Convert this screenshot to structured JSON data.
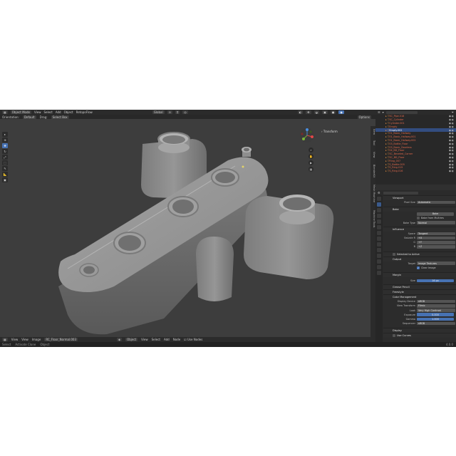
{
  "topbar": {
    "mode": "Object Mode",
    "menus": [
      "View",
      "Select",
      "Add",
      "Object",
      "RetopoFlow"
    ],
    "transform_orientation": "Global"
  },
  "toolsettings": {
    "orientation_label": "Orientation:",
    "orientation_value": "Default",
    "drag_label": "Drag:",
    "drag_value": "Select Box",
    "options": "Options"
  },
  "npanel": {
    "tab": "Transform"
  },
  "side_tabs": [
    "Item",
    "Tool",
    "View",
    "BlenderKit",
    "Mesh Machine",
    "Machine Tools"
  ],
  "outliner": {
    "search_placeholder": "",
    "rows": [
      {
        "name": "SC_Pipe.018",
        "red": true
      },
      {
        "name": "SC_Cylinder",
        "red": true
      },
      {
        "name": "Cylinder.001",
        "red": true
      },
      {
        "name": "Empty",
        "red": true
      },
      {
        "name": "Empty.002",
        "red": false,
        "highlight": true
      },
      {
        "name": "01_Basic_Hallway",
        "red": true
      },
      {
        "name": "01_Basic_Hallway.001",
        "red": true
      },
      {
        "name": "01_Basic_Hallway.002",
        "red": true
      },
      {
        "name": "03_Bottle_Floor",
        "red": true
      },
      {
        "name": "03_Basic_Doorless",
        "red": true
      },
      {
        "name": "04_BD_Floor",
        "red": true
      },
      {
        "name": "SC_Beveled_Corner",
        "red": true
      },
      {
        "name": "SC_BD_Floor",
        "red": true
      },
      {
        "name": "Ring_007",
        "red": true
      },
      {
        "name": "S_Bottle.005",
        "red": true
      },
      {
        "name": "S_Ring.015",
        "red": true
      },
      {
        "name": "S_Ring.016",
        "red": true
      }
    ]
  },
  "properties": {
    "viewport_section": "Viewport",
    "pixel_size_label": "Pixel Size",
    "pixel_size_value": "Automatic",
    "bake_section": "Bake",
    "bake_button": "Bake",
    "bake_from_multires": "Bake from Multires",
    "bake_type_label": "Bake Type",
    "bake_type_value": "Normal",
    "influence_section": "Influence",
    "space_label": "Space",
    "space_value": "Tangent",
    "swizzle_r_label": "Swizzle R",
    "swizzle_r": "+X",
    "swizzle_g_label": "G",
    "swizzle_g": "+Y",
    "swizzle_b_label": "B",
    "swizzle_b": "+Z",
    "selected_to_active": "Selected to Active",
    "output_section": "Output",
    "target_label": "Target",
    "target_value": "Image Textures",
    "clear_image": "Clear Image",
    "margin_section": "Margin",
    "size_label": "Size",
    "size_value": "16 px",
    "grease_pencil_section": "Grease Pencil",
    "freestyle_section": "Freestyle",
    "color_management_section": "Color Management",
    "display_device_label": "Display Device",
    "display_device_value": "sRGB",
    "view_transform_label": "View Transform",
    "view_transform_value": "Filmic",
    "look_label": "Look",
    "look_value": "Very High Contrast",
    "exposure_label": "Exposure",
    "exposure_value": "0.000",
    "gamma_label": "Gamma",
    "gamma_value": "1.000",
    "sequencer_label": "Sequencer",
    "sequencer_value": "sRGB",
    "display_section": "Display",
    "use_curves": "Use Curves"
  },
  "bottombar": {
    "items": [
      "View",
      "View",
      "Image"
    ],
    "image_name": "RC_Floor_Normal.003",
    "object_label": "Object",
    "menus": [
      "View",
      "Select",
      "Add",
      "Node"
    ],
    "use_nodes": "Use Nodes"
  },
  "statusbar": {
    "items": [
      "Select",
      "Activate Clone",
      "Object"
    ],
    "version": "4.0.0"
  }
}
